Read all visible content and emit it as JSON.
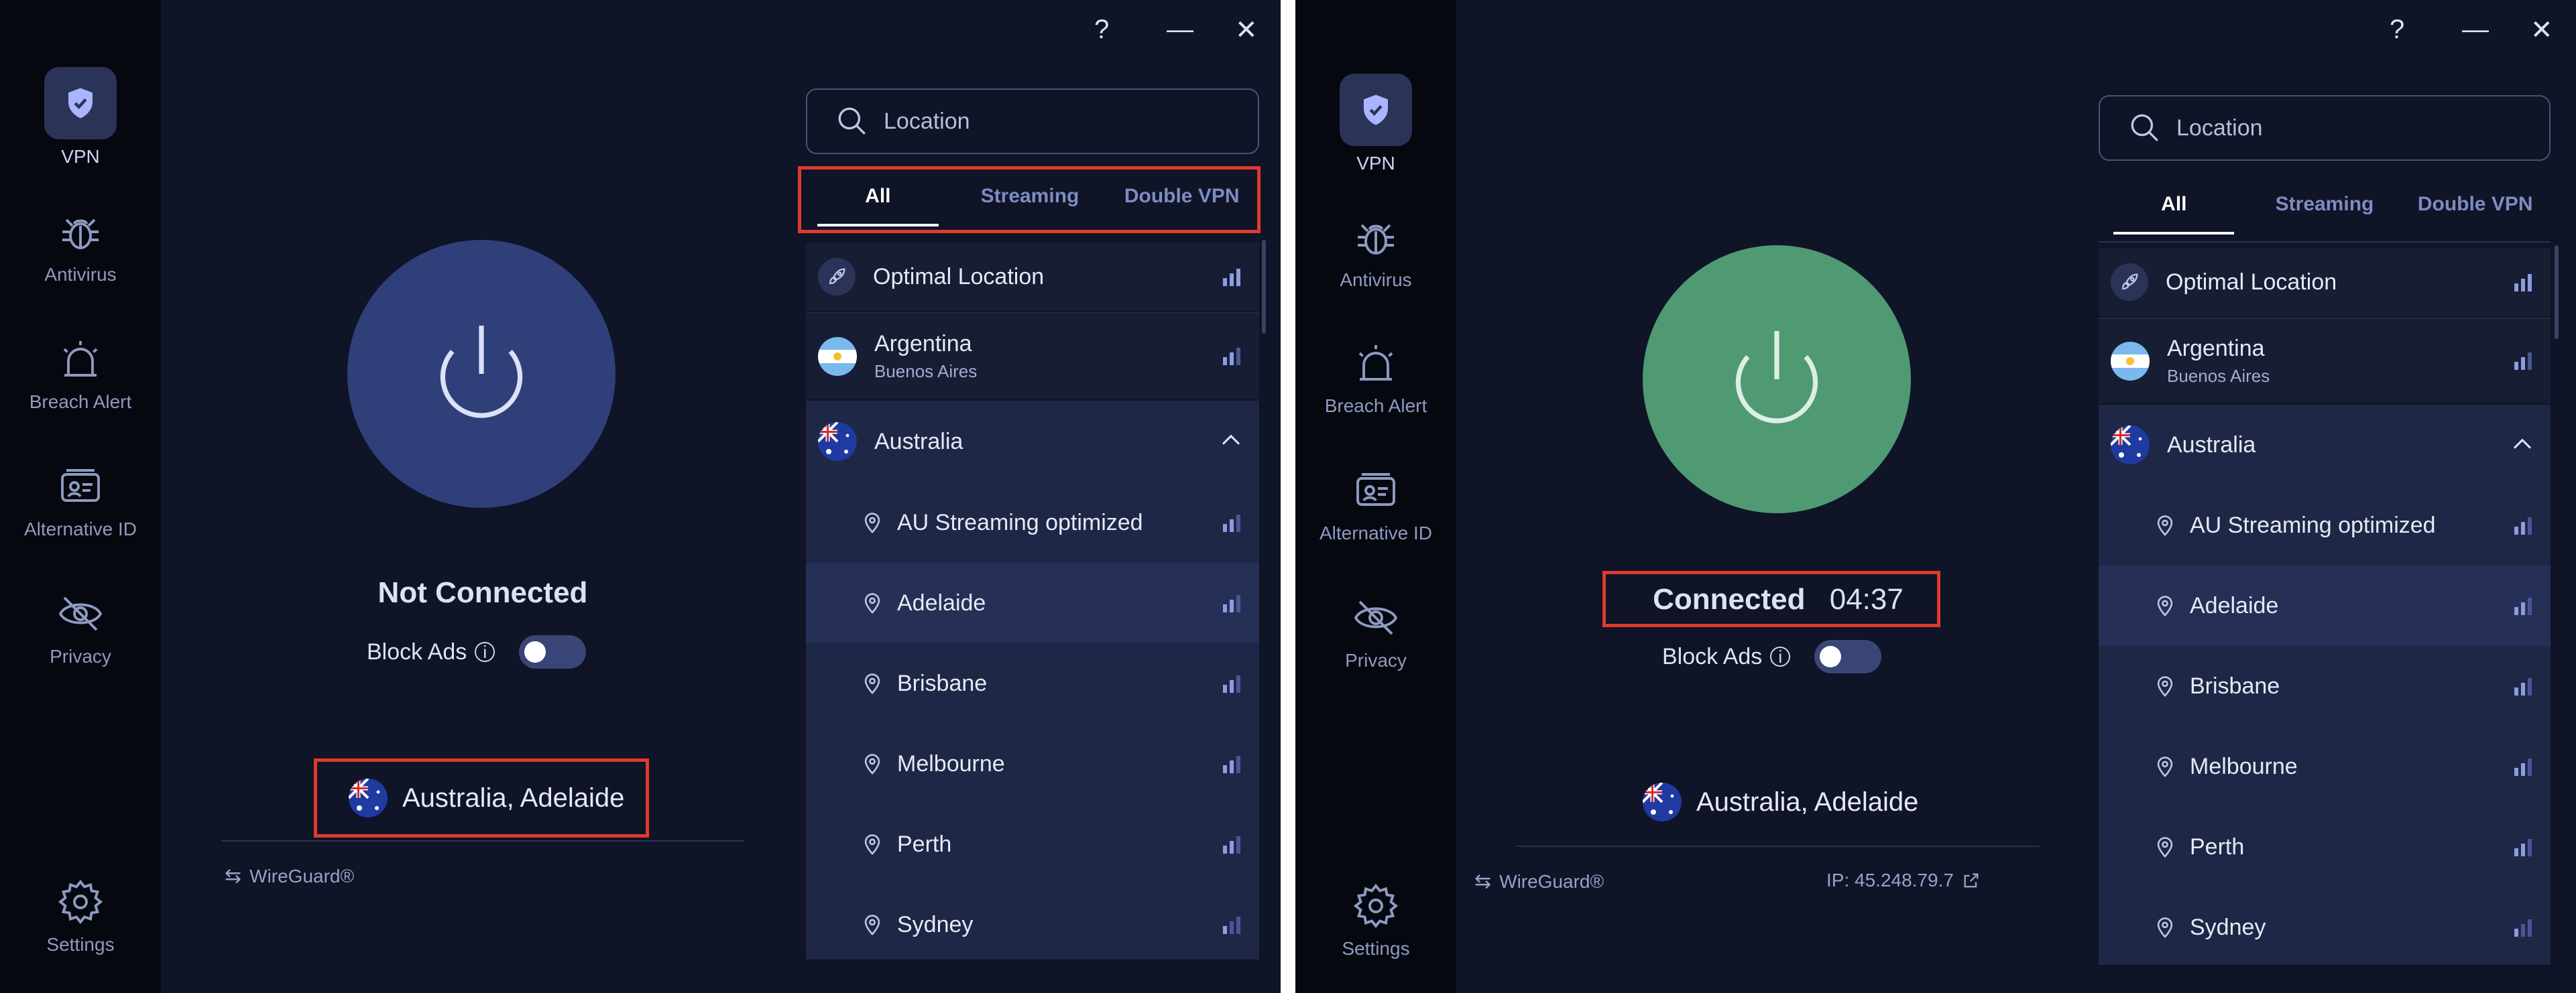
{
  "colors": {
    "highlight": "#e03a2f",
    "power_off": "#2f3f7a",
    "power_on": "#4f9a73"
  },
  "sidebar": {
    "items": [
      {
        "label": "VPN",
        "icon": "shield-check-icon"
      },
      {
        "label": "Antivirus",
        "icon": "bug-icon"
      },
      {
        "label": "Breach Alert",
        "icon": "alarm-light-icon"
      },
      {
        "label": "Alternative ID",
        "icon": "id-card-icon"
      },
      {
        "label": "Privacy",
        "icon": "eye-slash-icon"
      }
    ],
    "settings_label": "Settings"
  },
  "window_controls": {
    "help": "?",
    "minimize": "—",
    "close": "✕"
  },
  "left": {
    "status": "Not Connected",
    "block_ads_label": "Block Ads",
    "location": "Australia, Adelaide",
    "protocol": "WireGuard®"
  },
  "right": {
    "status": "Connected",
    "timer": "04:37",
    "block_ads_label": "Block Ads",
    "location": "Australia, Adelaide",
    "protocol": "WireGuard®",
    "ip": "IP: 45.248.79.7"
  },
  "search": {
    "placeholder": "Location"
  },
  "tabs": [
    "All",
    "Streaming",
    "Double VPN"
  ],
  "locations": {
    "optimal": "Optimal Location",
    "argentina": {
      "name": "Argentina",
      "city": "Buenos Aires"
    },
    "australia": "Australia",
    "cities": [
      "AU Streaming optimized",
      "Adelaide",
      "Brisbane",
      "Melbourne",
      "Perth",
      "Sydney"
    ]
  }
}
